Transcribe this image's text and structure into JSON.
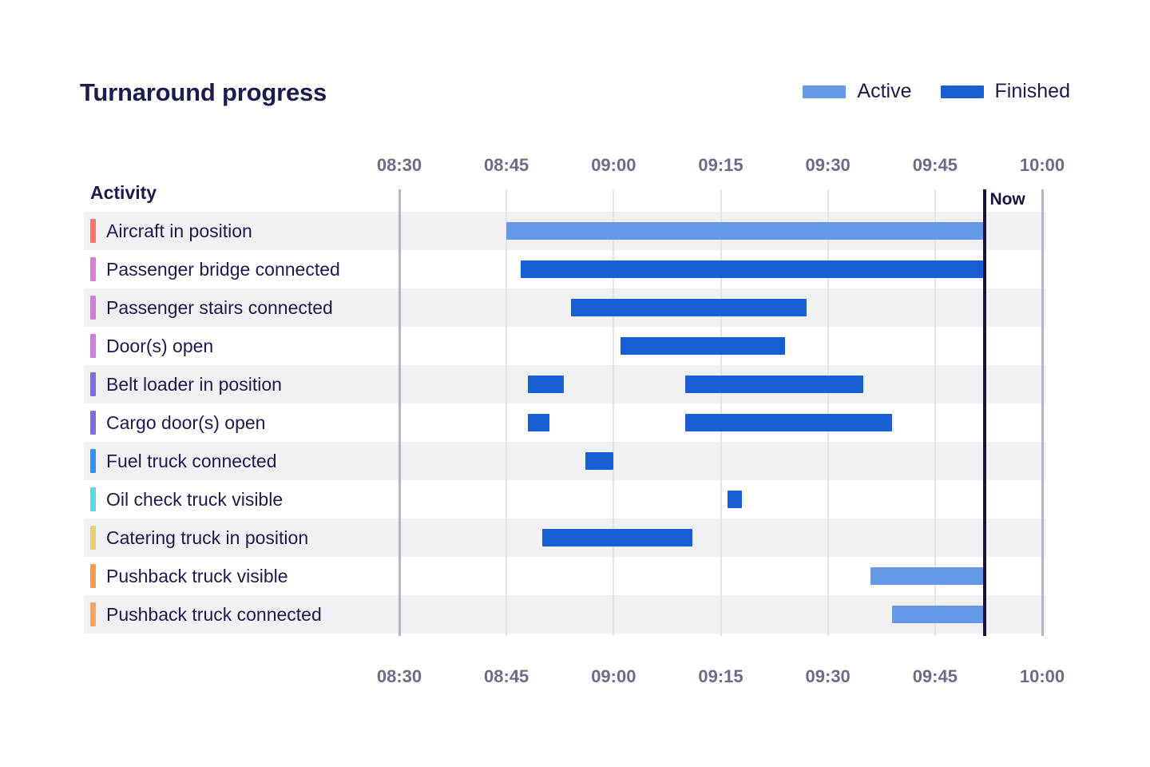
{
  "header": {
    "title": "Turnaround progress"
  },
  "legend": {
    "position": "top-right",
    "items": [
      {
        "label": "Active",
        "color": "#6698e8"
      },
      {
        "label": "Finished",
        "color": "#1a5ed4"
      }
    ]
  },
  "axis": {
    "label": "Activity",
    "ticks": [
      "08:30",
      "08:45",
      "09:00",
      "09:15",
      "09:30",
      "09:45",
      "10:00"
    ],
    "range": [
      "08:30",
      "10:00"
    ],
    "tick_interval_minutes": 15,
    "grid": true,
    "top_axis": true,
    "bottom_axis": true
  },
  "now_marker": {
    "label": "Now",
    "time": "09:52",
    "color": "#14143c"
  },
  "colors": {
    "active": "#6698e8",
    "finished": "#1a5ed4",
    "title": "#1b1b4d",
    "tick": "#6c6c8a",
    "row_stripe": "#f1f1f3",
    "gridline": "#e3e3e8",
    "axis_edge": "#b4b4c6"
  },
  "chart_data": {
    "type": "bar",
    "title": "Turnaround progress",
    "xlabel": "",
    "ylabel": "Activity",
    "xlim": [
      "08:30",
      "10:00"
    ],
    "x_ticks": [
      "08:30",
      "08:45",
      "09:00",
      "09:15",
      "09:30",
      "09:45",
      "10:00"
    ],
    "categories": [
      "Aircraft in position",
      "Passenger bridge connected",
      "Passenger stairs connected",
      "Door(s) open",
      "Belt loader in position",
      "Cargo door(s) open",
      "Fuel truck connected",
      "Oil check truck visible",
      "Catering truck in position",
      "Pushback truck visible",
      "Pushback truck connected"
    ],
    "series": [
      {
        "name": "Active",
        "color": "#6698e8"
      },
      {
        "name": "Finished",
        "color": "#1a5ed4"
      }
    ],
    "rows": [
      {
        "label": "Aircraft in position",
        "chip_color": "#f8766d",
        "segments": [
          {
            "start": "08:45",
            "end": "09:52",
            "status": "Active"
          }
        ]
      },
      {
        "label": "Passenger bridge connected",
        "chip_color": "#d87fd8",
        "segments": [
          {
            "start": "08:47",
            "end": "09:52",
            "status": "Finished"
          }
        ]
      },
      {
        "label": "Passenger stairs connected",
        "chip_color": "#d07fd8",
        "segments": [
          {
            "start": "08:54",
            "end": "09:27",
            "status": "Finished"
          }
        ]
      },
      {
        "label": "Door(s) open",
        "chip_color": "#cc7fdc",
        "segments": [
          {
            "start": "09:01",
            "end": "09:24",
            "status": "Finished"
          }
        ]
      },
      {
        "label": "Belt loader in position",
        "chip_color": "#7b6fdc",
        "segments": [
          {
            "start": "08:48",
            "end": "08:53",
            "status": "Finished"
          },
          {
            "start": "09:10",
            "end": "09:35",
            "status": "Finished"
          }
        ]
      },
      {
        "label": "Cargo door(s) open",
        "chip_color": "#7b6fdc",
        "segments": [
          {
            "start": "08:48",
            "end": "08:51",
            "status": "Finished"
          },
          {
            "start": "09:10",
            "end": "09:39",
            "status": "Finished"
          }
        ]
      },
      {
        "label": "Fuel truck connected",
        "chip_color": "#3a8ef0",
        "segments": [
          {
            "start": "08:56",
            "end": "09:00",
            "status": "Finished"
          }
        ]
      },
      {
        "label": "Oil check truck visible",
        "chip_color": "#5ed8dc",
        "segments": [
          {
            "start": "09:16",
            "end": "09:18",
            "status": "Finished"
          }
        ]
      },
      {
        "label": "Catering truck in position",
        "chip_color": "#e8d07a",
        "segments": [
          {
            "start": "08:50",
            "end": "09:11",
            "status": "Finished"
          }
        ]
      },
      {
        "label": "Pushback truck visible",
        "chip_color": "#f89a50",
        "segments": [
          {
            "start": "09:36",
            "end": "09:52",
            "status": "Active"
          }
        ]
      },
      {
        "label": "Pushback truck connected",
        "chip_color": "#f8a566",
        "segments": [
          {
            "start": "09:39",
            "end": "09:52",
            "status": "Active"
          }
        ]
      }
    ]
  }
}
